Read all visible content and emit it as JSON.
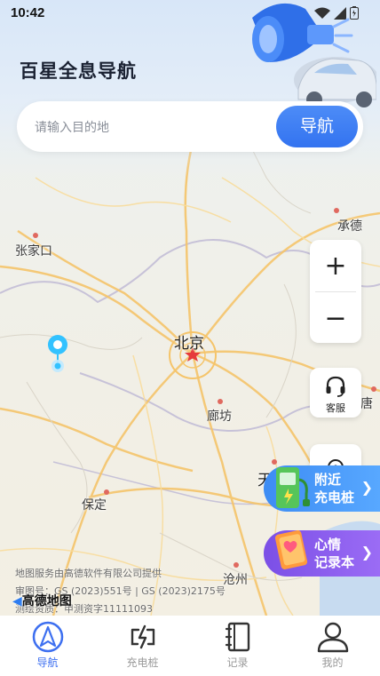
{
  "status_bar": {
    "time": "10:42"
  },
  "header": {
    "app_title": "百星全息导航"
  },
  "search": {
    "placeholder": "请输入目的地",
    "button_label": "导航"
  },
  "map": {
    "city_labels": {
      "chengde": "承德",
      "zhangjiakou": "张家口",
      "beijing": "北京",
      "langfang": "廊坊",
      "tianjin": "天",
      "tang": "唐",
      "baoding": "保定",
      "cangzhou": "沧州"
    },
    "provider": "地图服务由高德软件有限公司提供",
    "approval_no": "审图号：GS (2023)551号 | GS (2023)2175号",
    "survey_cert": "测绘资质：甲测资字11111093",
    "logo_text": "高德地图"
  },
  "controls": {
    "zoom_in": "+",
    "zoom_out": "−",
    "service_label": "客服"
  },
  "promo_cards": [
    {
      "line1": "附近",
      "line2": "充电桩"
    },
    {
      "line1": "心情",
      "line2": "记录本"
    }
  ],
  "tabbar": {
    "items": [
      {
        "label": "导航",
        "icon": "navigation-icon",
        "active": true
      },
      {
        "label": "充电桩",
        "icon": "charging-icon",
        "active": false
      },
      {
        "label": "记录",
        "icon": "notebook-icon",
        "active": false
      },
      {
        "label": "我的",
        "icon": "profile-icon",
        "active": false
      }
    ]
  },
  "colors": {
    "accent": "#3d6ff0",
    "search_button": "#3373f0",
    "card_charging": "#3d8cf4",
    "card_diary": "#7b4fe6"
  }
}
